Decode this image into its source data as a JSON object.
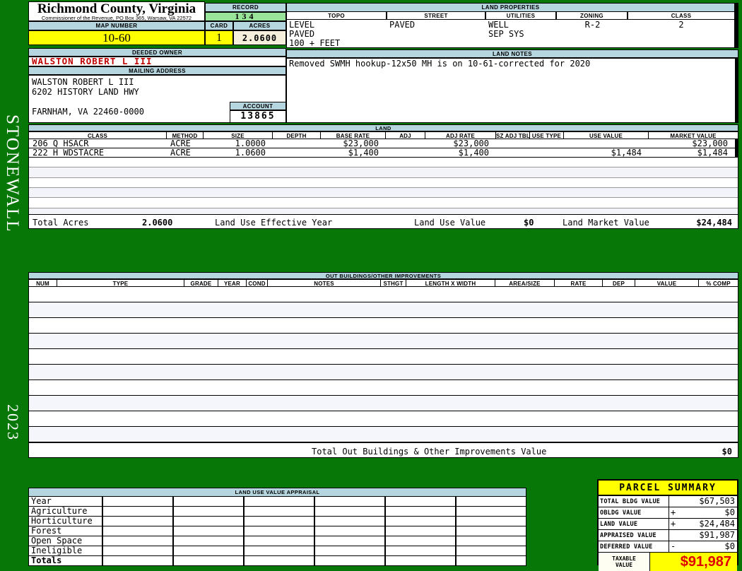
{
  "page": {
    "district": "STONEWALL",
    "year": "2023"
  },
  "header": {
    "county": "Richmond County, Virginia",
    "commissioner": "Commissioner of the Revenue, PO Box 365, Warsaw, VA 22572",
    "record_label": "RECORD",
    "record": "134",
    "map_number_label": "MAP NUMBER",
    "map_number": "10-60",
    "card_label": "CARD",
    "card": "1",
    "acres_label": "ACRES",
    "acres": "2.0600"
  },
  "land_properties": {
    "title": "LAND PROPERTIES",
    "columns": [
      "TOPO",
      "STREET",
      "UTILITIES",
      "ZONING",
      "CLASS"
    ],
    "topo": [
      "LEVEL",
      "PAVED",
      "100 + FEET"
    ],
    "street": [
      "PAVED"
    ],
    "utilities": [
      "WELL",
      "SEP SYS"
    ],
    "zoning": [
      "R-2"
    ],
    "class_value": [
      "2"
    ]
  },
  "owner": {
    "deeded_owner_label": "DEEDED OWNER",
    "deeded_owner": "WALSTON ROBERT L III",
    "mailing_address_label": "MAILING ADDRESS",
    "address_line1": "WALSTON ROBERT L III",
    "address_line2": "6202 HISTORY LAND HWY",
    "address_line3": "FARNHAM, VA 22460-0000",
    "account_label": "ACCOUNT",
    "account": "13865"
  },
  "land_notes": {
    "title": "LAND NOTES",
    "note": "Removed SWMH hookup-12x50 MH is on 10-61-corrected for 2020"
  },
  "land": {
    "title": "LAND",
    "columns": [
      "CLASS",
      "METHOD",
      "SIZE",
      "DEPTH",
      "BASE RATE",
      "ADJ",
      "ADJ RATE",
      "SZ ADJ TBL",
      "USE TYPE",
      "USE VALUE",
      "MARKET VALUE"
    ],
    "rows": [
      {
        "class": "206 Q HSACR",
        "method": "ACRE",
        "size": "1.0000",
        "depth": "",
        "base_rate": "$23,000",
        "adj": "",
        "adj_rate": "$23,000",
        "sz_adj_tbl": "",
        "use_type": "",
        "use_value": "",
        "market_value": "$23,000"
      },
      {
        "class": "222 H WDSTACRE",
        "method": "ACRE",
        "size": "1.0600",
        "depth": "",
        "base_rate": "$1,400",
        "adj": "",
        "adj_rate": "$1,400",
        "sz_adj_tbl": "",
        "use_type": "",
        "use_value": "$1,484",
        "market_value": "$1,484"
      }
    ],
    "total_acres_label": "Total Acres",
    "total_acres": "2.0600",
    "effective_year_label": "Land Use Effective Year",
    "use_value_label": "Land Use Value",
    "use_value": "$0",
    "market_value_label": "Land Market Value",
    "market_value": "$24,484"
  },
  "out_buildings": {
    "title": "OUT BUILDINGS/OTHER IMPROVEMENTS",
    "columns": [
      "NUM",
      "TYPE",
      "GRADE",
      "YEAR",
      "COND",
      "NOTES",
      "STHGT",
      "LENGTH X WIDTH",
      "AREA/SIZE",
      "RATE",
      "DEP",
      "VALUE",
      "% COMP"
    ],
    "total_label": "Total Out Buildings & Other Improvements Value",
    "total_value": "$0"
  },
  "land_use_appraisal": {
    "title": "LAND USE VALUE APPRAISAL",
    "row_labels": [
      "Year",
      "Agriculture",
      "Horticulture",
      "Forest",
      "Open Space",
      "Ineligible",
      "Totals"
    ],
    "data_columns": 6
  },
  "parcel_summary": {
    "title": "PARCEL SUMMARY",
    "rows": [
      {
        "label": "TOTAL BLDG VALUE",
        "op": "",
        "value": "$67,503"
      },
      {
        "label": "OBLDG VALUE",
        "op": "+",
        "value": "$0"
      },
      {
        "label": "LAND VALUE",
        "op": "+",
        "value": "$24,484"
      },
      {
        "label": "APPRAISED VALUE",
        "op": "",
        "value": "$91,987"
      },
      {
        "label": "DEFERRED VALUE",
        "op": "-",
        "value": "$0"
      }
    ],
    "taxable_label_line1": "TAXABLE",
    "taxable_label_line2": "VALUE",
    "taxable_value": "$91,987"
  },
  "colors": {
    "page_green": "#077807",
    "header_blue": "#b5d6de",
    "record_green": "#9ae49a",
    "highlight_yellow": "#ffff00",
    "acres_cream": "#f4eedb",
    "owner_red": "#c00000",
    "taxable_red": "#e00000"
  }
}
